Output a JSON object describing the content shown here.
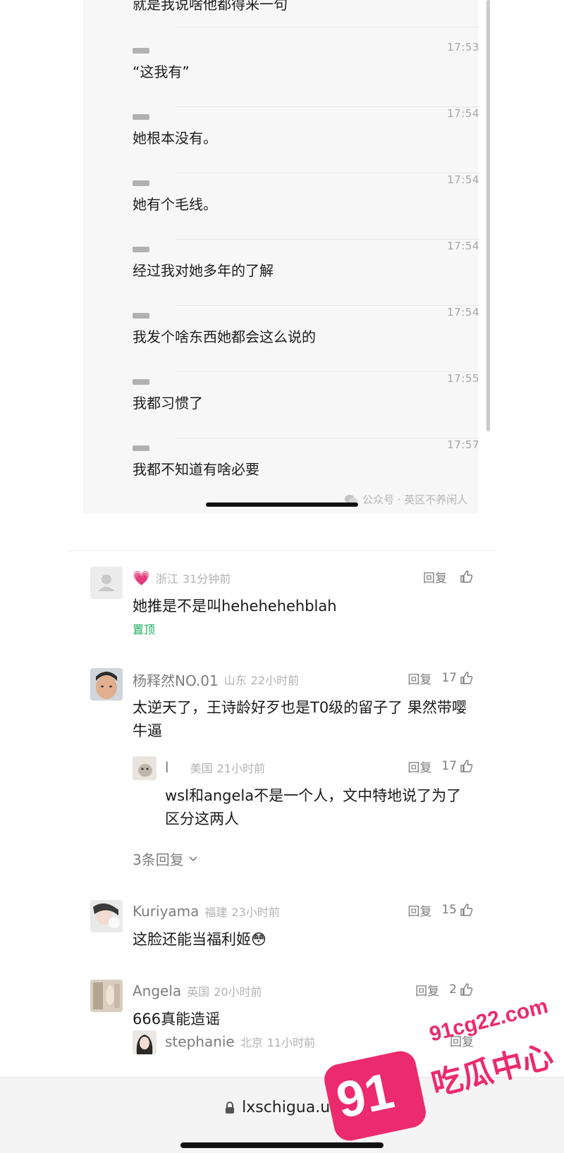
{
  "chat": {
    "first_line": "就是我说啥他都得来一句",
    "messages": [
      {
        "time": "17:53",
        "text": "“这我有”"
      },
      {
        "time": "17:54",
        "text": "她根本没有。"
      },
      {
        "time": "17:54",
        "text": "她有个毛线。"
      },
      {
        "time": "17:54",
        "text": "经过我对她多年的了解"
      },
      {
        "time": "17:54",
        "text": "我发个啥东西她都会这么说的"
      },
      {
        "time": "17:55",
        "text": "我都习惯了"
      },
      {
        "time": "17:57",
        "text": "我都不知道有啥必要"
      }
    ],
    "source": "公众号 · 英区不养闲人"
  },
  "comments": [
    {
      "name": "💗",
      "location": "浙江",
      "time": "31分钟前",
      "reply_label": "回复",
      "likes": "",
      "text": "她推是不是叫hehehehehblah",
      "pinned": "置顶"
    },
    {
      "name": "杨释然NO.01",
      "location": "山东",
      "time": "22小时前",
      "reply_label": "回复",
      "likes": "17",
      "text": "太逆天了，王诗龄好歹也是T0级的留子了 果然带嘤牛逼"
    },
    {
      "name": "l",
      "location": "美国",
      "time": "21小时前",
      "reply_label": "回复",
      "likes": "17",
      "text": "wsl和angela不是一个人，文中特地说了为了区分这两人"
    },
    {
      "name": "Kuriyama",
      "location": "福建",
      "time": "23小时前",
      "reply_label": "回复",
      "likes": "15",
      "text": "这脸还能当福利姬😳"
    },
    {
      "name": "Angela",
      "location": "英国",
      "time": "20小时前",
      "reply_label": "回复",
      "likes": "2",
      "text": "666真能造谣"
    },
    {
      "name": "stephanie",
      "location": "北京",
      "time": "11小时前",
      "reply_label": "回复",
      "likes": "",
      "text": ""
    }
  ],
  "more_replies": "3条回复",
  "browser": {
    "url": "lxschigua.uk"
  },
  "watermark": {
    "domain": "91cg22.com",
    "title": "吃瓜中心",
    "badge": "91"
  },
  "colors": {
    "accent": "#1aad5e",
    "watermark": "#ec2a6e"
  }
}
